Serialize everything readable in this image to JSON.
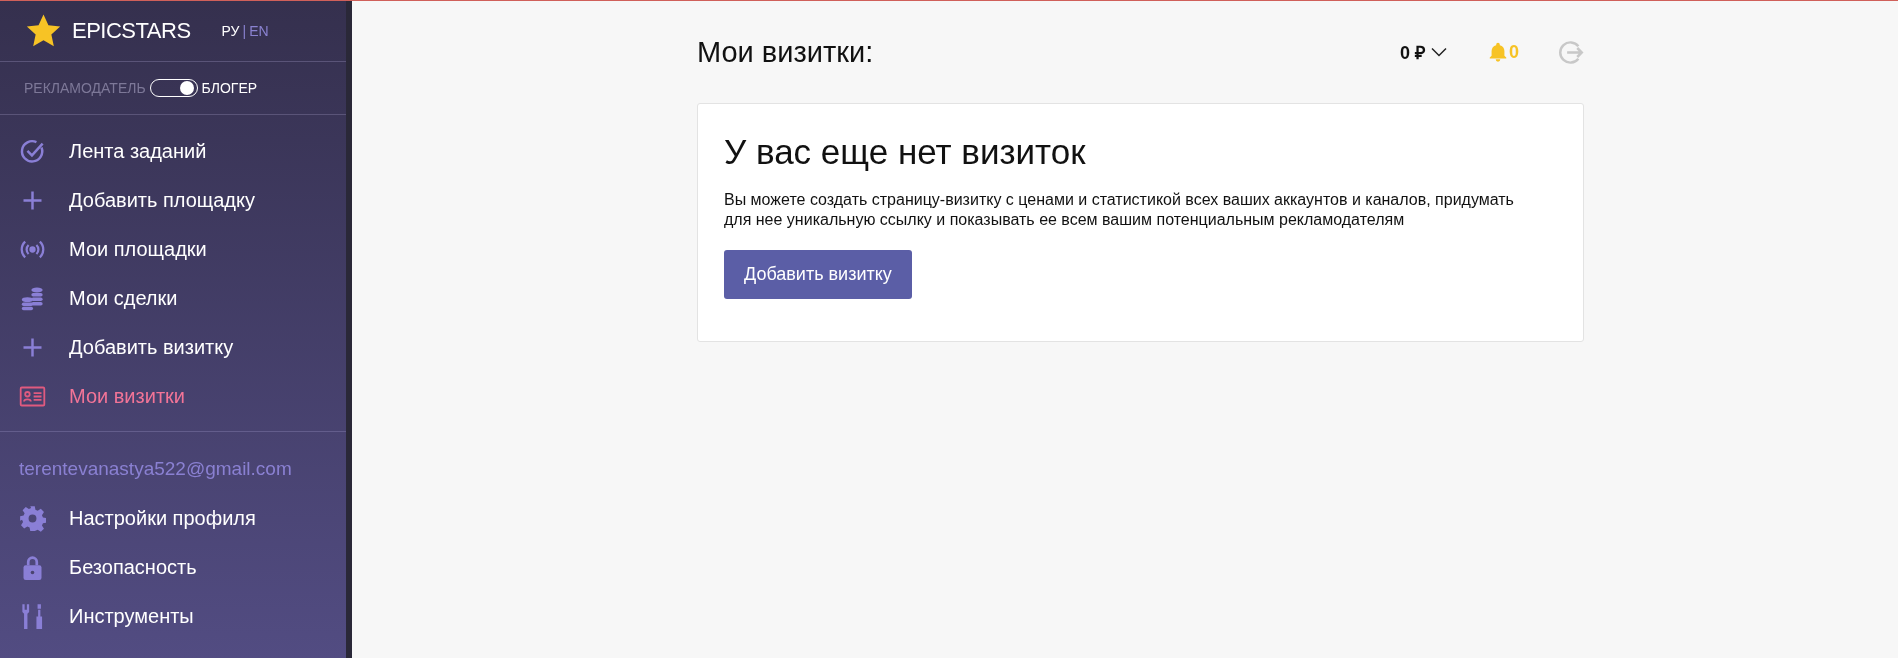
{
  "sidebar": {
    "logo": "EPICSTARS",
    "languages": [
      {
        "label": "РУ",
        "selected": true
      },
      {
        "label": "EN",
        "selected": false
      }
    ],
    "language_separator": "|",
    "mode_switch": {
      "left_label": "РЕКЛАМОДАТЕЛЬ",
      "right_label": "БЛОГЕР",
      "on": true
    },
    "items": [
      {
        "label": "Лента заданий",
        "selected": false
      },
      {
        "label": "Добавить площадку",
        "selected": false
      },
      {
        "label": "Мои площадки",
        "selected": false
      },
      {
        "label": "Мои сделки",
        "selected": false
      },
      {
        "label": "Добавить визитку",
        "selected": false
      },
      {
        "label": "Мои визитки",
        "selected": true
      }
    ],
    "email": "terentevanastya522@gmail.com",
    "account_items": [
      {
        "label": "Настройки профиля"
      },
      {
        "label": "Безопасность"
      },
      {
        "label": "Инструменты"
      }
    ]
  },
  "header": {
    "title": "Мои визитки:",
    "balance": "0 ₽",
    "notifications": "0"
  },
  "card": {
    "heading": "У вас еще нет визиток",
    "text": "Вы можете создать страницу-визитку с ценами и статистикой всех ваших аккаунтов и каналов, придумать для нее уникальную ссылку и показывать ее всем вашим потенциальным рекламодателям",
    "button": "Добавить визитку"
  }
}
